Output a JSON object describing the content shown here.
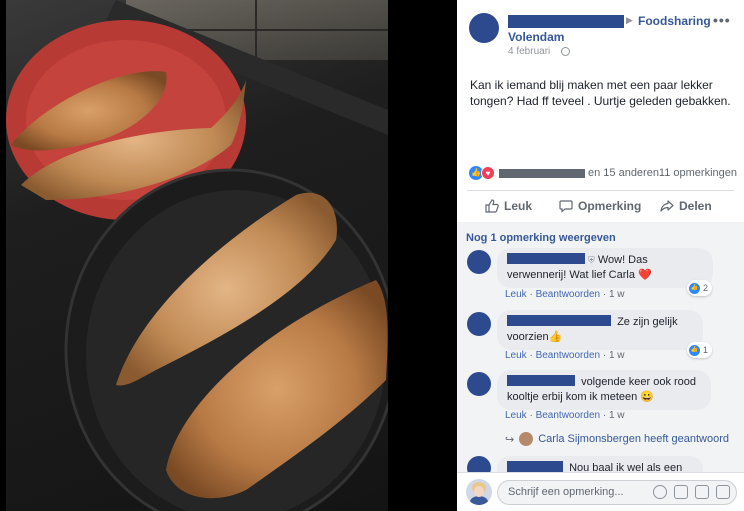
{
  "post": {
    "group_name": "Foodsharing",
    "group_name_line2": "Volendam",
    "date": "4 februari",
    "text": "Kan ik iemand blij maken met een paar lekker tongen? Had ff teveel . Uurtje geleden gebakken.",
    "reactions_others": "en 15 anderen",
    "comment_count": "11 opmerkingen",
    "more_options": "•••"
  },
  "actions": {
    "like": "Leuk",
    "comment": "Opmerking",
    "share": "Delen"
  },
  "comments_section": {
    "more_comments": "Nog 1 opmerking weergeven",
    "comments": [
      {
        "text_line1": "Wow! Das",
        "text_line2": "verwennerij! Wat lief Carla ❤️",
        "like": "Leuk",
        "reply": "Beantwoorden",
        "time": "1 w",
        "reaction_count": "2"
      },
      {
        "text_line1": "Ze zijn gelijk",
        "text_line2": "voorzien👍",
        "like": "Leuk",
        "reply": "Beantwoorden",
        "time": "1 w",
        "reaction_count": "1"
      },
      {
        "text_line1": "volgende keer ook rood",
        "text_line2": "kooltje erbij kom ik meteen 😀",
        "like": "Leuk",
        "reply": "Beantwoorden",
        "time": "1 w"
      },
      {
        "text_line1": "Nou baal ik wel als een"
      }
    ],
    "reply_note": "Carla Sijmonsbergen heeft geantwoord"
  },
  "composer": {
    "placeholder": "Schrijf een opmerking..."
  },
  "colors": {
    "link": "#365899",
    "redaction": "#2e4a8f",
    "like_blue": "#2d88ff",
    "heart_red": "#f33e58"
  }
}
